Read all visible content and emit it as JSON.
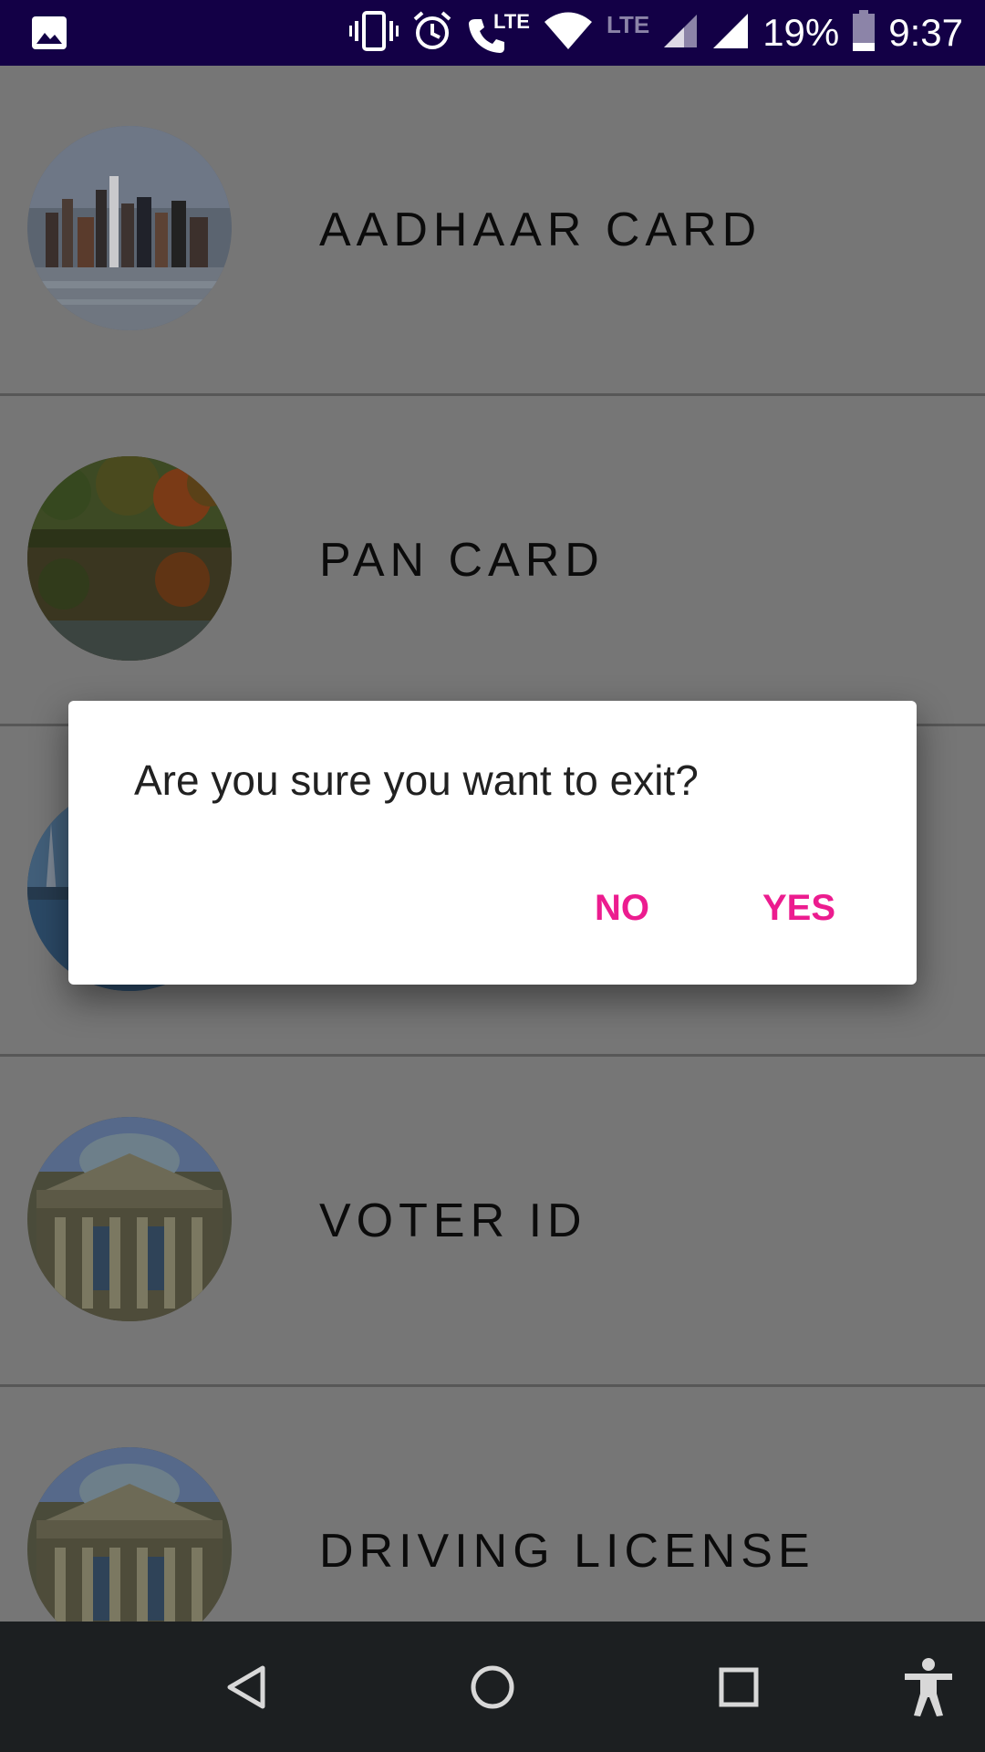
{
  "status_bar": {
    "lte_call_label": "LTE",
    "lte_dim_label": "LTE",
    "battery_percent": "19%",
    "time": "9:37",
    "icons": [
      "gallery-icon",
      "vibrate-icon",
      "alarm-icon",
      "volte-call-icon",
      "wifi-icon",
      "signal-icon",
      "battery-icon"
    ]
  },
  "list": {
    "items": [
      {
        "label": "AADHAAR CARD",
        "thumb": "city-skyline"
      },
      {
        "label": "PAN CARD",
        "thumb": "autumn-lake"
      },
      {
        "label": "",
        "thumb": "bridge-tower"
      },
      {
        "label": "VOTER ID",
        "thumb": "parliament-building"
      },
      {
        "label": "DRIVING LICENSE",
        "thumb": "parliament-building"
      }
    ]
  },
  "dialog": {
    "message": "Are you sure you want to exit?",
    "no_label": "NO",
    "yes_label": "YES",
    "accent": "#ec1c8f"
  },
  "nav_bar": {
    "icons": [
      "back-icon",
      "home-icon",
      "recents-icon",
      "accessibility-icon"
    ]
  }
}
